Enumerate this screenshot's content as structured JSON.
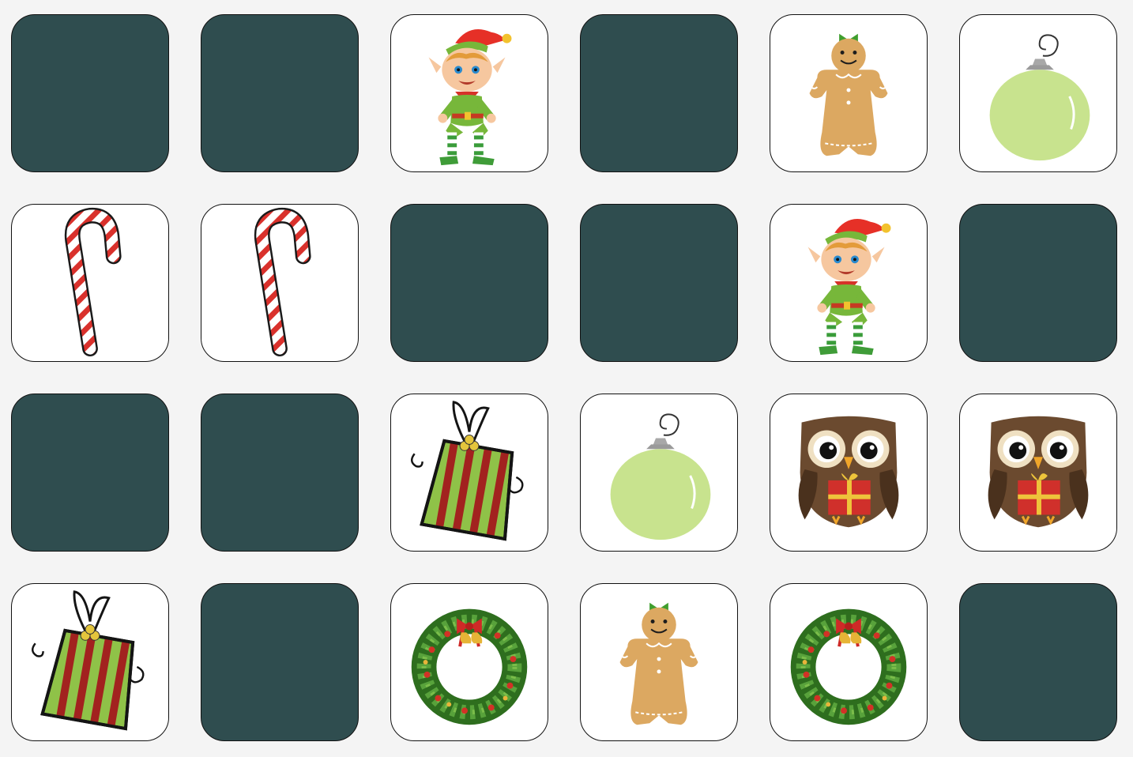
{
  "game": {
    "rows": 4,
    "columns": 6,
    "card_back_color": "#2f4d4f",
    "card_face_color": "#ffffff",
    "cards": [
      {
        "state": "hidden"
      },
      {
        "state": "hidden"
      },
      {
        "state": "revealed",
        "icon": "elf-icon"
      },
      {
        "state": "hidden"
      },
      {
        "state": "revealed",
        "icon": "gingerbread-icon"
      },
      {
        "state": "revealed",
        "icon": "ornament-icon"
      },
      {
        "state": "revealed",
        "icon": "candy-cane-icon"
      },
      {
        "state": "revealed",
        "icon": "candy-cane-icon"
      },
      {
        "state": "hidden"
      },
      {
        "state": "hidden"
      },
      {
        "state": "revealed",
        "icon": "elf-icon"
      },
      {
        "state": "hidden"
      },
      {
        "state": "hidden"
      },
      {
        "state": "hidden"
      },
      {
        "state": "revealed",
        "icon": "gift-icon"
      },
      {
        "state": "revealed",
        "icon": "ornament-icon"
      },
      {
        "state": "revealed",
        "icon": "owl-icon"
      },
      {
        "state": "revealed",
        "icon": "owl-icon"
      },
      {
        "state": "revealed",
        "icon": "gift-icon"
      },
      {
        "state": "hidden"
      },
      {
        "state": "revealed",
        "icon": "wreath-icon"
      },
      {
        "state": "revealed",
        "icon": "gingerbread-icon"
      },
      {
        "state": "revealed",
        "icon": "wreath-icon"
      },
      {
        "state": "hidden"
      }
    ]
  }
}
